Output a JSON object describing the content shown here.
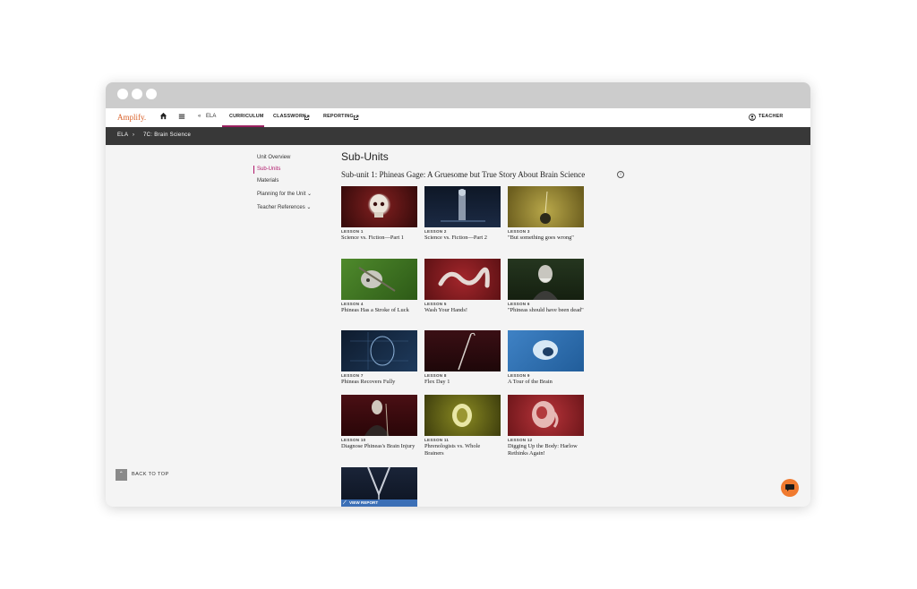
{
  "app": {
    "logo": "Amplify.",
    "nav": {
      "back_label": "ELA",
      "back_icon": "«",
      "tabs": [
        {
          "label": "CURRICULUM"
        },
        {
          "label": "CLASSWORK"
        },
        {
          "label": "REPORTING"
        }
      ],
      "user_label": "TEACHER"
    }
  },
  "breadcrumb": [
    "ELA",
    "7C: Brain Science"
  ],
  "sidebar": {
    "items": [
      {
        "label": "Unit Overview"
      },
      {
        "label": "Sub-Units"
      },
      {
        "label": "Materials"
      },
      {
        "label": "Planning for the Unit ⌄"
      },
      {
        "label": "Teacher References ⌄"
      }
    ],
    "back_to_top": "BACK TO TOP"
  },
  "main": {
    "title": "Sub-Units",
    "subunit_title": "Sub-unit 1: Phineas Gage: A Gruesome but True Story About Brain Science",
    "lessons": [
      {
        "number": "LESSON 1",
        "title": "Science vs. Fiction—Part 1"
      },
      {
        "number": "LESSON 2",
        "title": "Science vs. Fiction—Part 2"
      },
      {
        "number": "LESSON 3",
        "title": "\"But something goes wrong\""
      },
      {
        "number": "LESSON 4",
        "title": "Phineas Has a Stroke of Luck"
      },
      {
        "number": "LESSON 5",
        "title": "Wash Your Hands!"
      },
      {
        "number": "LESSON 6",
        "title": "\"Phineas should have been dead\""
      },
      {
        "number": "LESSON 7",
        "title": "Phineas Recovers Fully"
      },
      {
        "number": "LESSON 8",
        "title": "Flex Day 1"
      },
      {
        "number": "LESSON 9",
        "title": "A Tour of the Brain"
      },
      {
        "number": "LESSON 10",
        "title": "Diagnose Phineas's Brain Injury"
      },
      {
        "number": "LESSON 11",
        "title": "Phrenologists vs. Whole Brainers"
      },
      {
        "number": "LESSON 12",
        "title": "Digging Up the Body: Harlow Rethinks Again!"
      }
    ],
    "view_report": "VIEW REPORT"
  },
  "colors": {
    "accent": "#b0186b",
    "logo": "#d9622b",
    "breadcrumb_bg": "#383838",
    "view_report": "#3b6fb6",
    "chat": "#f07a2f"
  },
  "icons": [
    "home-icon",
    "menu-icon",
    "external-link-icon",
    "user-icon",
    "info-icon",
    "chevron-up-icon",
    "chat-icon",
    "chart-line-icon"
  ]
}
